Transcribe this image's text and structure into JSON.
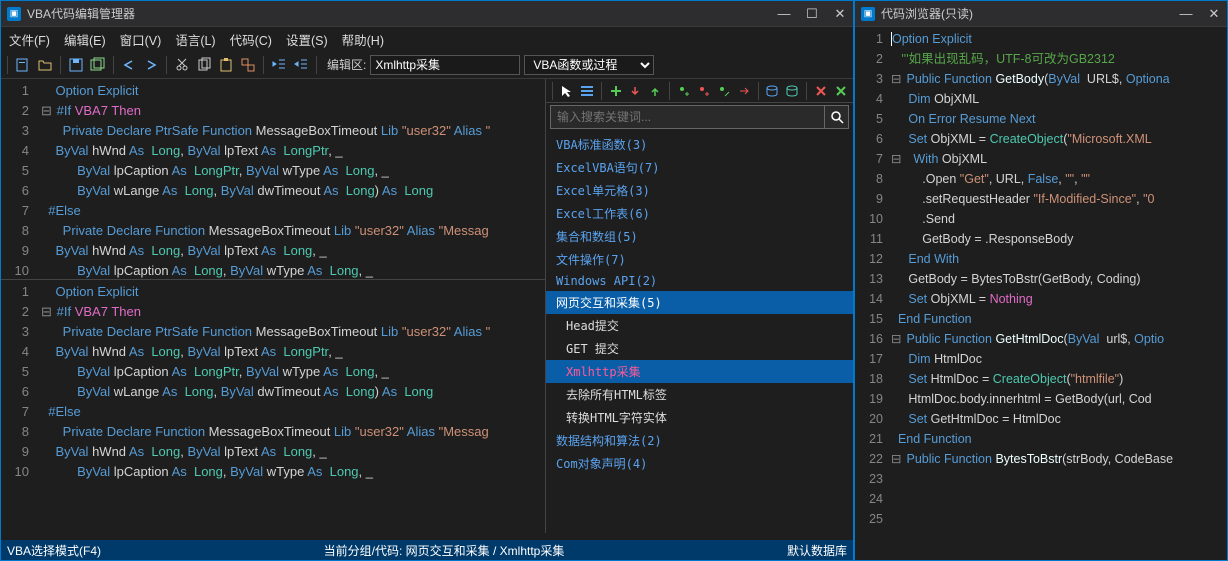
{
  "leftTitle": "VBA代码编辑管理器",
  "rightTitle": "代码浏览器(只读)",
  "menus": [
    "文件(F)",
    "编辑(E)",
    "窗口(V)",
    "语言(L)",
    "代码(C)",
    "设置(S)",
    "帮助(H)"
  ],
  "editAreaLabel": "编辑区:",
  "editAreaValue": "Xmlhttp采集",
  "dropdownValue": "VBA函数或过程",
  "searchPlaceholder": "输入搜索关键词...",
  "tree": [
    {
      "label": "VBA标准函数(3)",
      "sel": false
    },
    {
      "label": "ExcelVBA语句(7)",
      "sel": false
    },
    {
      "label": "Excel单元格(3)",
      "sel": false
    },
    {
      "label": "Excel工作表(6)",
      "sel": false
    },
    {
      "label": "集合和数组(5)",
      "sel": false
    },
    {
      "label": "文件操作(7)",
      "sel": false
    },
    {
      "label": "Windows API(2)",
      "sel": false
    },
    {
      "label": "网页交互和采集(5)",
      "sel": true,
      "children": [
        {
          "label": "Head提交",
          "sel": false
        },
        {
          "label": "GET 提交",
          "sel": false
        },
        {
          "label": "Xmlhttp采集",
          "sel": true
        },
        {
          "label": "去除所有HTML标签",
          "sel": false
        },
        {
          "label": "转换HTML字符实体",
          "sel": false
        }
      ]
    },
    {
      "label": "数据结构和算法(2)",
      "sel": false
    },
    {
      "label": "Com对象声明(4)",
      "sel": false
    }
  ],
  "status": {
    "left": "VBA选择模式(F4)",
    "mid": "当前分组/代码:  网页交互和采集  /  Xmlhttp采集",
    "right": "默认数据库"
  },
  "code1": [
    "    Option Explicit",
    "⊟ #If VBA7 Then",
    "      Private Declare PtrSafe Function MessageBoxTimeout Lib \"user32\" Alias \"",
    "    ByVal hWnd As  Long, ByVal lpText As  LongPtr, _",
    "          ByVal lpCaption As  LongPtr, ByVal wType As  Long, _",
    "          ByVal wLange As  Long, ByVal dwTimeout As  Long) As  Long",
    "  #Else",
    "      Private Declare Function MessageBoxTimeout Lib \"user32\" Alias \"Messag",
    "    ByVal hWnd As  Long, ByVal lpText As  Long, _",
    "          ByVal lpCaption As  Long, ByVal wType As  Long, _"
  ],
  "rcodeLines": 25
}
